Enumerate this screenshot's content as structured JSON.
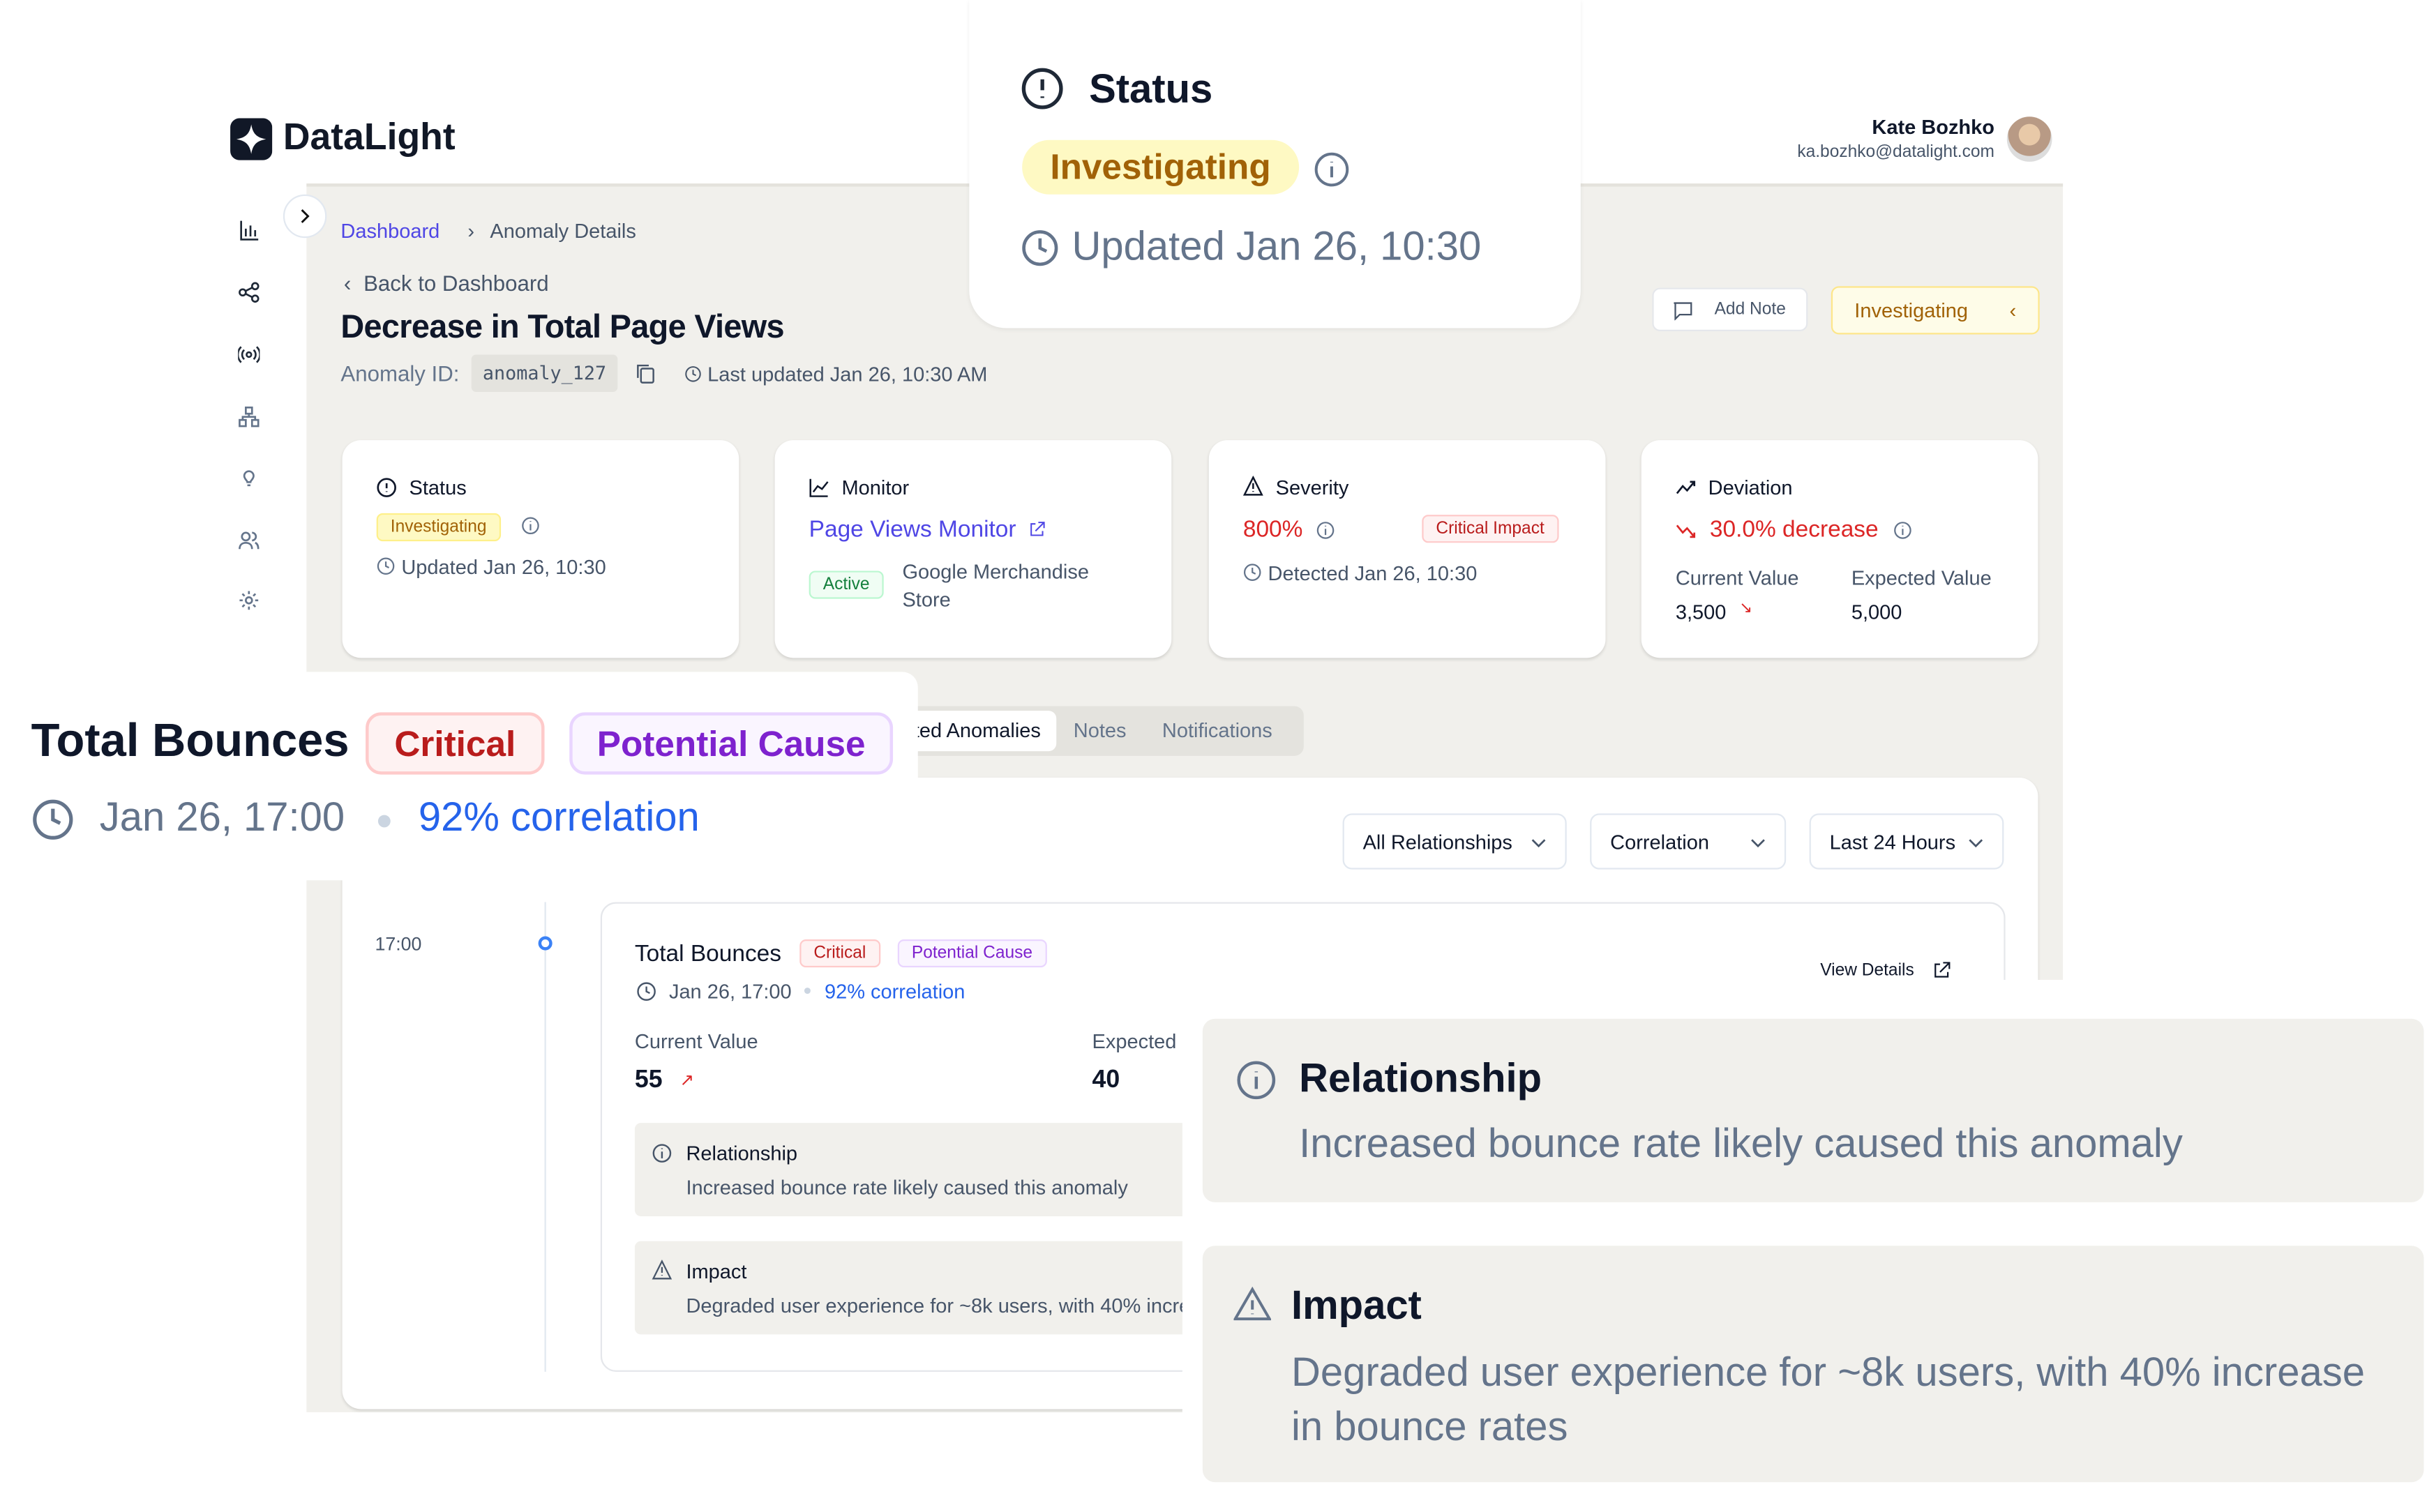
{
  "header": {
    "logo_text": "DataLight",
    "user_name": "Kate Bozhko",
    "user_email": "ka.bozhko@datalight.com"
  },
  "sidebar": {
    "items": [
      "chart-bar-icon",
      "share-icon",
      "broadcast-icon",
      "hierarchy-icon",
      "lightbulb-icon",
      "users-icon",
      "gear-icon"
    ]
  },
  "breadcrumb": {
    "home": "Dashboard",
    "current": "Anomaly Details"
  },
  "page": {
    "back_label": "Back to Dashboard",
    "title": "Decrease in Total Page Views",
    "anomaly_id_label": "Anomaly ID:",
    "anomaly_id": "anomaly_127",
    "last_updated": "Last updated Jan 26, 10:30 AM"
  },
  "actions": {
    "add_note": "Add Note",
    "status_button": "Investigating"
  },
  "cards": {
    "status": {
      "title": "Status",
      "badge": "Investigating",
      "updated": "Updated Jan 26, 10:30"
    },
    "monitor": {
      "title": "Monitor",
      "name": "Page Views Monitor",
      "badge": "Active",
      "source": "Google Merchandise Store"
    },
    "severity": {
      "title": "Severity",
      "value": "800%",
      "badge": "Critical Impact",
      "detected": "Detected Jan 26, 10:30"
    },
    "deviation": {
      "title": "Deviation",
      "value": "30.0% decrease",
      "current_label": "Current Value",
      "current_value": "3,500",
      "expected_label": "Expected Value",
      "expected_value": "5,000"
    }
  },
  "tabs": [
    {
      "label": "Related Anomalies",
      "active": true
    },
    {
      "label": "Notes",
      "active": false
    },
    {
      "label": "Notifications",
      "active": false
    }
  ],
  "filters": [
    "All Relationships",
    "Correlation",
    "Last 24 Hours"
  ],
  "timeline": {
    "time": "17:00",
    "event": {
      "title": "Total Bounces",
      "severity": "Critical",
      "relation": "Potential Cause",
      "date": "Jan 26, 17:00",
      "correlation": "92% correlation",
      "current_label": "Current Value",
      "current_value": "55",
      "expected_label": "Expected",
      "expected_value": "40",
      "view_details": "View Details",
      "relationship": {
        "title": "Relationship",
        "text": "Increased bounce rate likely caused this anomaly"
      },
      "impact": {
        "title": "Impact",
        "text": "Degraded user experience for ~8k users, with 40% increase in bounce rates"
      }
    }
  },
  "colors": {
    "accent_blue": "#2563eb",
    "link": "#4f46e5",
    "critical": "#dc2626",
    "warning": "#a16207",
    "purple": "#7e22ce",
    "background": "#f1f0ec"
  }
}
